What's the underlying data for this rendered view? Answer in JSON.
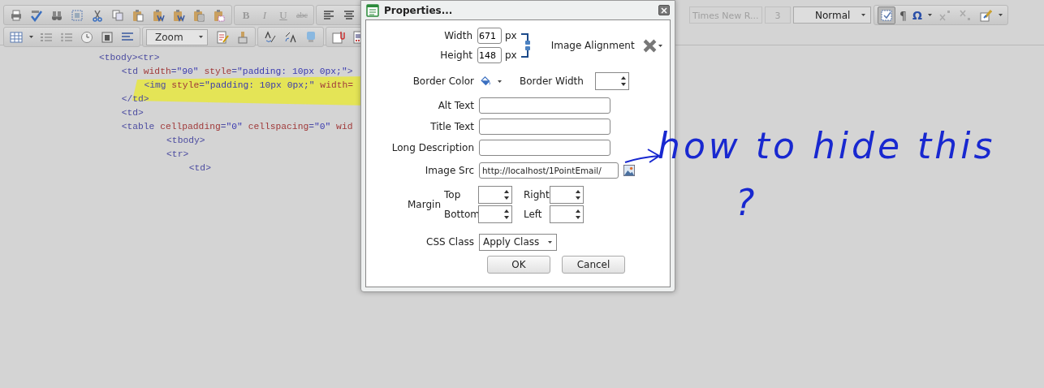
{
  "toolbar": {
    "format_glyphs": [
      "B",
      "I",
      "U",
      "abc"
    ],
    "format_disabled": true,
    "zoom": "Zoom",
    "font": "Times New R...",
    "size": "3",
    "font_disabled": true,
    "paragraph_style": "Normal",
    "symbols": [
      "¶",
      "Ω"
    ],
    "show_borders_pressed": true
  },
  "code_lines": [
    {
      "highlighted": false,
      "tokens": [
        {
          "kind": "tag",
          "text": "<tbody><tr>"
        }
      ],
      "children": [
        {
          "highlighted": false,
          "tokens": [
            {
              "kind": "tag",
              "text": "<td"
            },
            {
              "kind": "attr",
              "text": " width"
            },
            {
              "kind": "punct",
              "text": "="
            },
            {
              "kind": "value",
              "text": "\"90\""
            },
            {
              "kind": "attr",
              "text": " style"
            },
            {
              "kind": "punct",
              "text": "="
            },
            {
              "kind": "value",
              "text": "\"padding: 10px 0px;\""
            },
            {
              "kind": "tag",
              "text": ">"
            }
          ],
          "children": [
            {
              "highlighted": true,
              "tokens": [
                {
                  "kind": "tag",
                  "text": "<img"
                },
                {
                  "kind": "attr",
                  "text": " style"
                },
                {
                  "kind": "punct",
                  "text": "="
                },
                {
                  "kind": "value",
                  "text": "\"padding: 10px 0px;\""
                },
                {
                  "kind": "attr",
                  "text": " width="
                }
              ]
            }
          ]
        },
        {
          "highlighted": false,
          "tokens": [
            {
              "kind": "tag",
              "text": "</td>"
            }
          ]
        },
        {
          "highlighted": false,
          "tokens": [
            {
              "kind": "tag",
              "text": "<td>"
            }
          ]
        },
        {
          "highlighted": false,
          "tokens": [
            {
              "kind": "tag",
              "text": "<table"
            },
            {
              "kind": "attr",
              "text": " cellpadding"
            },
            {
              "kind": "punct",
              "text": "="
            },
            {
              "kind": "value",
              "text": "\"0\""
            },
            {
              "kind": "attr",
              "text": " cellspacing"
            },
            {
              "kind": "punct",
              "text": "="
            },
            {
              "kind": "value",
              "text": "\"0\""
            },
            {
              "kind": "attr",
              "text": " wid"
            }
          ],
          "children": [
            {
              "children": [
                {
                  "highlighted": false,
                  "tokens": [
                    {
                      "kind": "tag",
                      "text": "<tbody>"
                    }
                  ]
                },
                {
                  "highlighted": false,
                  "tokens": [
                    {
                      "kind": "tag",
                      "text": "<tr>"
                    }
                  ],
                  "children": [
                    {
                      "highlighted": false,
                      "tokens": [
                        {
                          "kind": "tag",
                          "text": "<td>"
                        }
                      ]
                    }
                  ]
                }
              ]
            }
          ]
        }
      ]
    }
  ],
  "dialog": {
    "title": "Properties...",
    "width_label": "Width",
    "width_value": "671",
    "height_label": "Height",
    "height_value": "148",
    "unit": "px",
    "unit2": "px",
    "alignment_label": "Image Alignment",
    "border_color_label": "Border Color",
    "border_width_label": "Border Width",
    "text_fields": [
      {
        "label": "Alt Text"
      },
      {
        "label": "Title Text"
      },
      {
        "label": "Long Description"
      }
    ],
    "image_src_label": "Image Src",
    "image_src_value": "http://localhost/1PointEmail/",
    "margin_label": "Margin",
    "margins": [
      {
        "label": "Top"
      },
      {
        "label": "Right"
      },
      {
        "label": "Bottom"
      },
      {
        "label": "Left"
      }
    ],
    "css_class_label": "CSS Class",
    "css_class_value": "Apply Class",
    "buttons": [
      "OK",
      "Cancel"
    ]
  },
  "annotation": {
    "text": "how to hide this",
    "mark": "?"
  }
}
